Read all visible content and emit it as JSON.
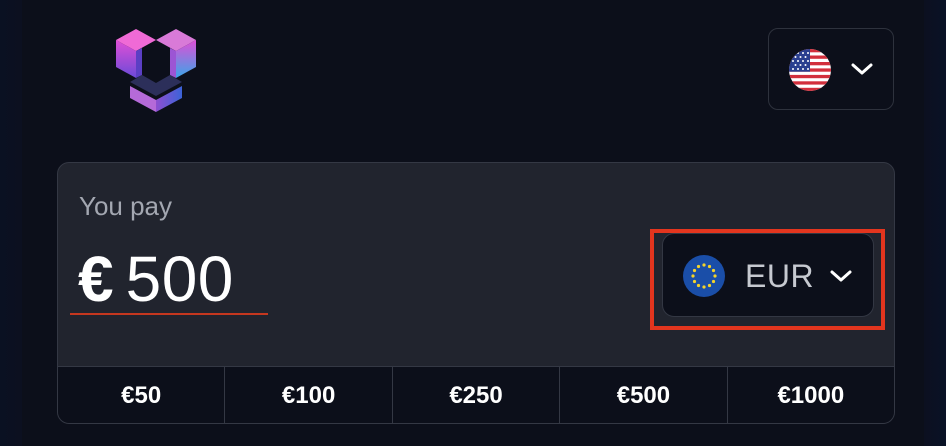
{
  "header": {
    "logo_icon": "cube-logo-icon",
    "language": {
      "flag": "us-flag-icon",
      "chevron": "chevron-down-icon"
    }
  },
  "payment": {
    "label": "You pay",
    "currency_symbol": "€",
    "amount": "500",
    "currency": {
      "code": "EUR",
      "flag": "eu-flag-icon",
      "chevron": "chevron-down-icon"
    },
    "presets": [
      "€50",
      "€100",
      "€250",
      "€500",
      "€1000"
    ]
  },
  "colors": {
    "background": "#0c0f1a",
    "card": "#21242e",
    "highlight": "#e3351e",
    "underline": "#c5371f"
  }
}
